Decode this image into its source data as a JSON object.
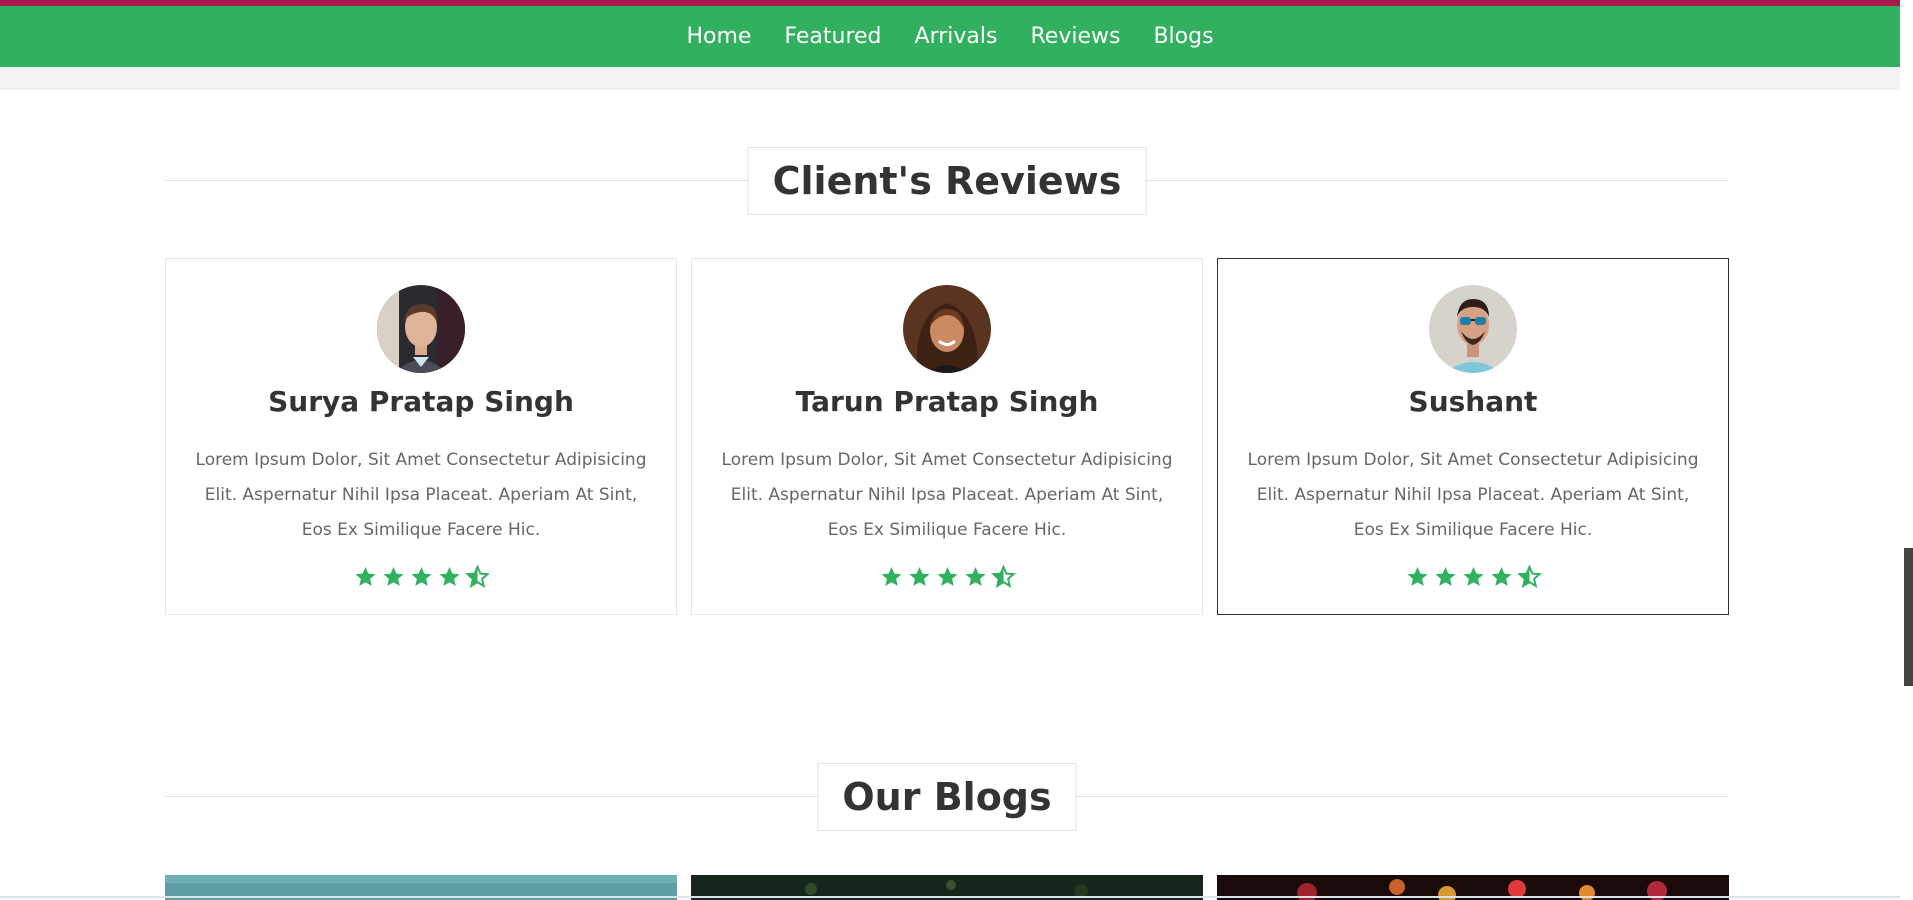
{
  "nav": {
    "items": [
      {
        "label": "Home"
      },
      {
        "label": "Featured"
      },
      {
        "label": "Arrivals"
      },
      {
        "label": "Reviews"
      },
      {
        "label": "Blogs"
      }
    ]
  },
  "reviews": {
    "heading": "Client's Reviews",
    "cards": [
      {
        "name": "Surya Pratap Singh",
        "text": "Lorem Ipsum Dolor, Sit Amet Consectetur Adipisicing Elit. Aspernatur Nihil Ipsa Placeat. Aperiam At Sint, Eos Ex Similique Facere Hic.",
        "rating": 4.5,
        "avatar_icon": "man-portrait-avatar"
      },
      {
        "name": "Tarun Pratap Singh",
        "text": "Lorem Ipsum Dolor, Sit Amet Consectetur Adipisicing Elit. Aspernatur Nihil Ipsa Placeat. Aperiam At Sint, Eos Ex Similique Facere Hic.",
        "rating": 4.5,
        "avatar_icon": "woman-portrait-avatar"
      },
      {
        "name": "Sushant",
        "text": "Lorem Ipsum Dolor, Sit Amet Consectetur Adipisicing Elit. Aspernatur Nihil Ipsa Placeat. Aperiam At Sint, Eos Ex Similique Facere Hic.",
        "rating": 4.5,
        "avatar_icon": "man-sunglasses-avatar"
      }
    ]
  },
  "blogs": {
    "heading": "Our Blogs"
  },
  "colors": {
    "brand_green": "#31b05f",
    "top_strip": "#a6184f",
    "heading_text": "#333333",
    "body_text": "#666666"
  }
}
